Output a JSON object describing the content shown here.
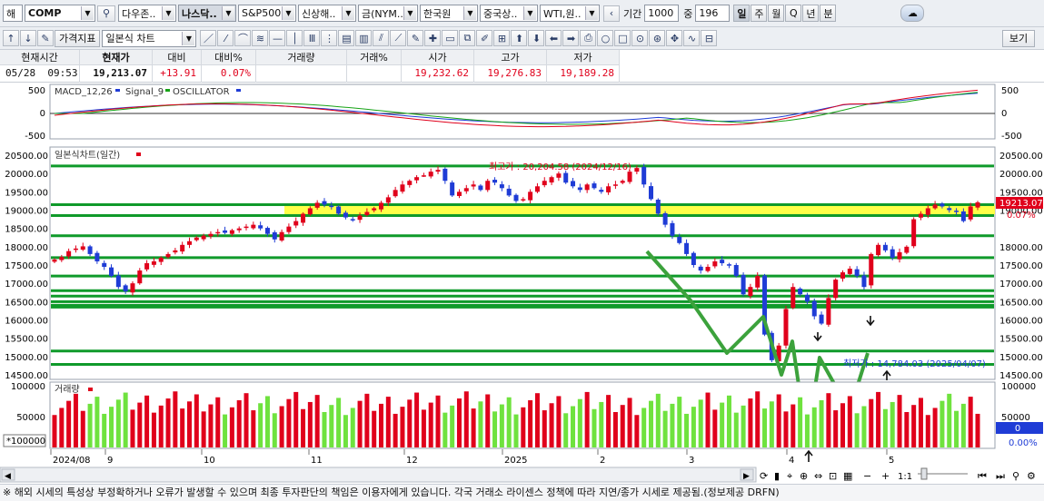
{
  "toolbar1": {
    "market_type": "해",
    "symbol": "COMP",
    "tabs": [
      "다우존..",
      "나스닥..",
      "S&P500",
      "신상해..",
      "금(NYM..",
      "한국원",
      "중국상..",
      "WTI,원.."
    ],
    "active_tab": 1,
    "period_label": "기간",
    "period_value": "1000",
    "count_label": "중",
    "count_value": "196",
    "intervals": [
      "일",
      "주",
      "월",
      "Q",
      "년",
      "분"
    ],
    "active_interval": 0
  },
  "toolbar2": {
    "indicator_label": "가격지표",
    "chart_type": "일본식 차트",
    "view_button": "보기"
  },
  "quote": {
    "headers": [
      "현재시간",
      "현재가",
      "대비",
      "대비%",
      "거래량",
      "거래%",
      "시가",
      "고가",
      "저가"
    ],
    "date": "05/28",
    "time": "09:53",
    "price": "19,213.07",
    "change": "+13.91",
    "change_pct": "0.07%",
    "volume": "",
    "volume_pct": "",
    "open": "19,232.62",
    "high": "19,276.83",
    "low": "19,189.28"
  },
  "macd": {
    "legend": [
      "MACD_12,26",
      "Signal_9",
      "OSCILLATOR"
    ],
    "legend_colors": [
      "#1f3cd6",
      "#16a316",
      "#1f3cd6"
    ],
    "y_ticks": [
      "500",
      "0",
      "-500"
    ]
  },
  "price_panel": {
    "title": "일본식차트(일간)",
    "y_ticks": [
      "20500.00",
      "20000.00",
      "19500.00",
      "19000.00",
      "18500.00",
      "18000.00",
      "17500.00",
      "17000.00",
      "16500.00",
      "16000.00",
      "15500.00",
      "15000.00",
      "14500.00"
    ],
    "right_ticks": [
      "20500.00",
      "20000.00",
      "19500.00",
      "19000.00",
      "18000.00",
      "17500.00",
      "17000.00",
      "16500.00",
      "16000.00",
      "15500.00",
      "15000.00",
      "14500.00"
    ],
    "current_price_tag": "19213.07",
    "current_change_tag": "0.07%",
    "high_annotation": "최고가 : 20,204.58 (2024/12/16)",
    "low_annotation": "최저가 : 14,784.03 (2025/04/07)",
    "tag_color": "#e0001b"
  },
  "volume_panel": {
    "title": "거래량",
    "y_ticks": [
      "100000",
      "50000"
    ],
    "unit": "*100000",
    "right_tag": "0",
    "right_pct": "0.00%"
  },
  "x_axis": {
    "labels": [
      "2024/08",
      "9",
      "10",
      "11",
      "12",
      "2025",
      "2",
      "3",
      "4",
      "5"
    ]
  },
  "scrollbar": {
    "scale_label": "1:1"
  },
  "footer": {
    "text": "※ 해외 시세의 특성상 부정확하거나 오류가 발생할 수 있으며 최종 투자판단의 책임은 이용자에게 있습니다. 각국 거래소 라이센스 정책에 따라 지연/종가 시세로 제공됨.(정보제공 DRFN)"
  },
  "chart_data": {
    "type": "candlestick",
    "period": "daily",
    "series_values_close": [
      17650,
      17720,
      17880,
      17950,
      18010,
      17800,
      17600,
      17450,
      17200,
      16900,
      16780,
      17000,
      17350,
      17550,
      17600,
      17700,
      17800,
      17900,
      18050,
      18150,
      18250,
      18300,
      18350,
      18400,
      18380,
      18450,
      18500,
      18550,
      18600,
      18500,
      18350,
      18200,
      18400,
      18550,
      18700,
      18900,
      19050,
      19200,
      19150,
      19100,
      18900,
      18800,
      18750,
      18850,
      18950,
      19050,
      19200,
      19350,
      19550,
      19700,
      19800,
      19900,
      19950,
      20050,
      20100,
      19800,
      19400,
      19500,
      19600,
      19700,
      19550,
      19800,
      19750,
      19600,
      19400,
      19250,
      19300,
      19500,
      19650,
      19800,
      19900,
      20000,
      19750,
      19650,
      19550,
      19700,
      19600,
      19500,
      19650,
      19700,
      19800,
      20050,
      20150,
      19700,
      19300,
      18900,
      18600,
      18300,
      18100,
      17800,
      17500,
      17350,
      17450,
      17600,
      17550,
      17500,
      17200,
      16700,
      16900,
      17200,
      15600,
      14900,
      15300,
      16300,
      16900,
      16700,
      16500,
      16100,
      15900,
      16600,
      17100,
      17300,
      17400,
      17200,
      16900,
      17800,
      18050,
      17900,
      17700,
      17850,
      18000,
      18750,
      18900,
      19050,
      19150,
      19100,
      19000,
      18950,
      18700,
      19100,
      19213
    ],
    "horizontal_levels": [
      20204.58,
      19150,
      18850,
      18300,
      17700,
      17200,
      16800,
      16650,
      16500,
      16400,
      16350,
      15150,
      14784.03
    ],
    "highlight_band": [
      18880,
      19150
    ],
    "ylim": [
      14500,
      20500
    ],
    "annotations": [
      {
        "label": "최고가 : 20,204.58 (2024/12/16)",
        "value": 20204.58
      },
      {
        "label": "최저가 : 14,784.03 (2025/04/07)",
        "value": 14784.03
      }
    ]
  }
}
